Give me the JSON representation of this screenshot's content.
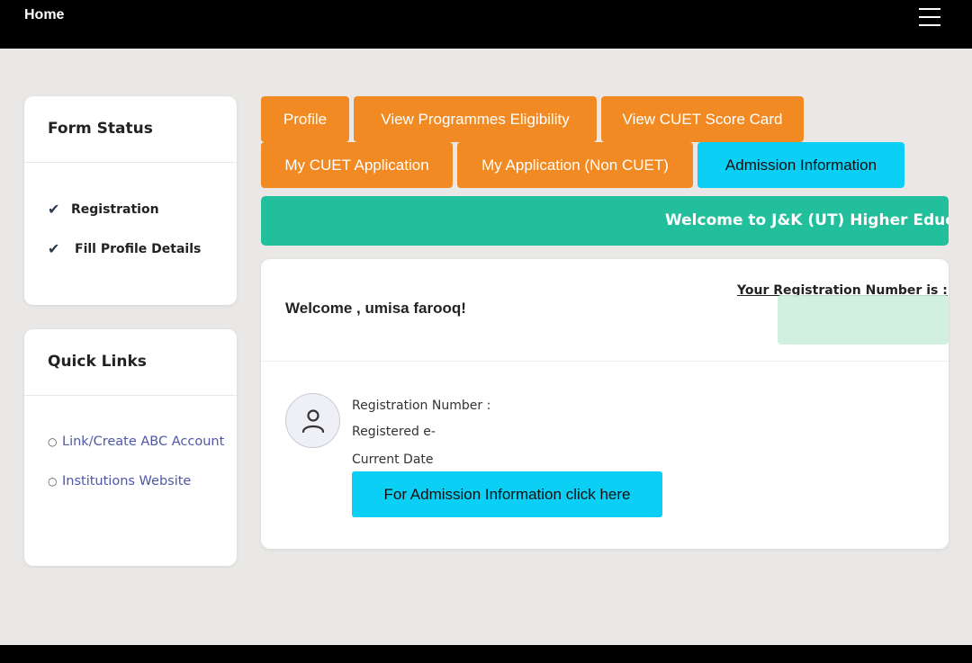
{
  "nav": {
    "home": "Home",
    "menu_icon": "hamburger-menu-icon"
  },
  "form_status": {
    "title": "Form Status",
    "items": [
      {
        "label": "Registration",
        "icon": "checkmark-icon"
      },
      {
        "label": "Fill Profile Details",
        "icon": "checkmark-icon"
      }
    ]
  },
  "quick_links": {
    "title": "Quick Links",
    "items": [
      {
        "label": "Link/Create ABC Account"
      },
      {
        "label": "Institutions Website"
      }
    ]
  },
  "buttons": {
    "profile": "Profile",
    "view_eligibility": "View Programmes Eligibility",
    "view_score_card": "View CUET Score Card",
    "my_cuet_application": "My CUET Application",
    "my_application_non_cuet": "My Application (Non CUET)",
    "admission_information": "Admission Information"
  },
  "banner": {
    "text": "Welcome to J&K (UT) Higher Education"
  },
  "main": {
    "welcome": "Welcome , umisa farooq!",
    "registration_number_label": "Your Registration Number is :",
    "registration_number_field": "Registration Number :",
    "registered_email_field": "Registered e-",
    "current_date_field": "Current Date",
    "admission_button": "For Admission Information click here"
  },
  "colors": {
    "orange": "#f28a24",
    "cyan": "#0bcff5",
    "banner_green": "#21bf9b",
    "link_blue": "#4f57a8"
  }
}
